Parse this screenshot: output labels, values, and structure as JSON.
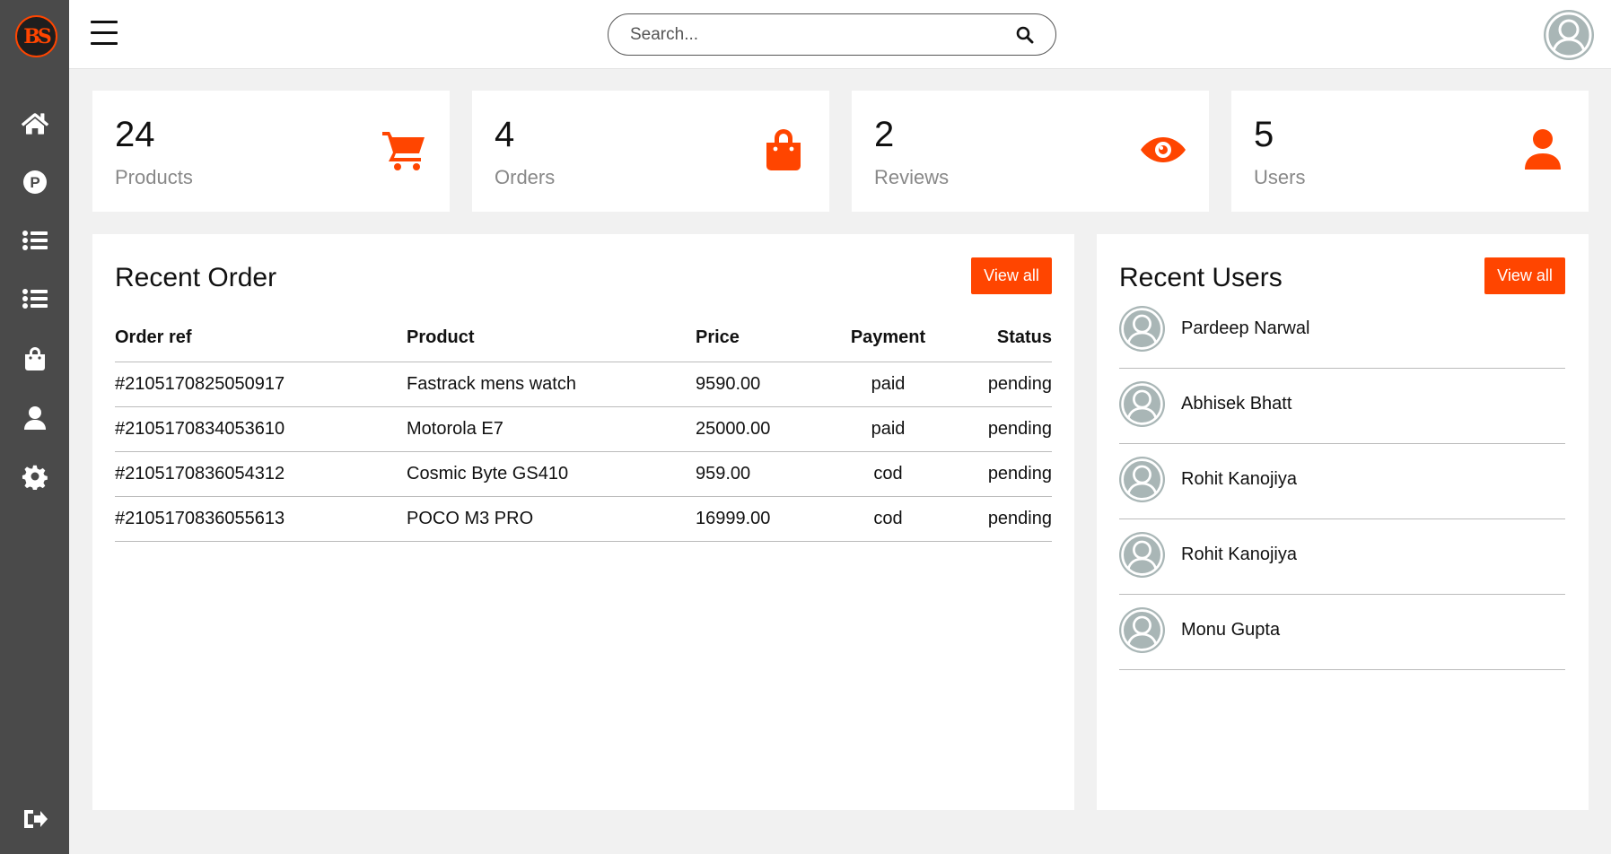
{
  "brand": {
    "logo_text": "BS"
  },
  "sidebar": {
    "items": [
      {
        "icon": "home-icon"
      },
      {
        "icon": "p-circle-icon"
      },
      {
        "icon": "list-icon"
      },
      {
        "icon": "list-icon"
      },
      {
        "icon": "shopping-bag-icon"
      },
      {
        "icon": "user-icon"
      },
      {
        "icon": "gear-icon"
      }
    ],
    "logout_icon": "logout-icon"
  },
  "header": {
    "search_placeholder": "Search...",
    "search_value": ""
  },
  "stats": [
    {
      "value": "24",
      "label": "Products",
      "icon": "cart-icon"
    },
    {
      "value": "4",
      "label": "Orders",
      "icon": "shopping-bag-icon"
    },
    {
      "value": "2",
      "label": "Reviews",
      "icon": "eye-icon"
    },
    {
      "value": "5",
      "label": "Users",
      "icon": "user-icon"
    }
  ],
  "recent_orders": {
    "title": "Recent Order",
    "view_all_label": "View all",
    "columns": [
      "Order ref",
      "Product",
      "Price",
      "Payment",
      "Status"
    ],
    "rows": [
      [
        "#2105170825050917",
        "Fastrack mens watch",
        "9590.00",
        "paid",
        "pending"
      ],
      [
        "#2105170834053610",
        "Motorola E7",
        "25000.00",
        "paid",
        "pending"
      ],
      [
        "#2105170836054312",
        "Cosmic Byte GS410",
        "959.00",
        "cod",
        "pending"
      ],
      [
        "#2105170836055613",
        "POCO M3 PRO",
        "16999.00",
        "cod",
        "pending"
      ]
    ]
  },
  "recent_users": {
    "title": "Recent Users",
    "view_all_label": "View all",
    "users": [
      "Pardeep Narwal",
      "Abhisek Bhatt",
      "Rohit Kanojiya",
      "Rohit Kanojiya",
      "Monu Gupta"
    ]
  },
  "colors": {
    "accent": "#ff4500",
    "sidebar": "#4a4a4a",
    "background": "#f1f1f1"
  }
}
